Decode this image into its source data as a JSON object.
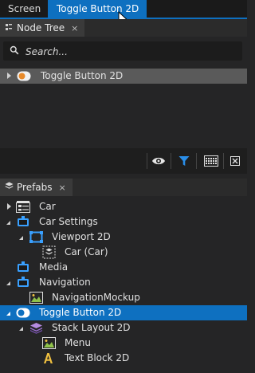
{
  "document_tabs": [
    {
      "label": "Screen"
    },
    {
      "label": "Toggle Button 2D",
      "close": "×"
    }
  ],
  "node_tree": {
    "title": "Node Tree",
    "close": "×",
    "search": {
      "placeholder": "Search..."
    },
    "items": [
      {
        "label": "Toggle Button 2D",
        "selected": true
      }
    ]
  },
  "prefabs": {
    "title": "Prefabs",
    "close": "×",
    "items": [
      {
        "label": "Car"
      },
      {
        "label": "Car Settings"
      },
      {
        "label": "Viewport 2D"
      },
      {
        "label": "Car (Car)"
      },
      {
        "label": "Media"
      },
      {
        "label": "Navigation"
      },
      {
        "label": "NavigationMockup"
      },
      {
        "label": "Toggle Button 2D",
        "selected": true
      },
      {
        "label": "Stack Layout 2D"
      },
      {
        "label": "Menu"
      },
      {
        "label": "Text Block 2D"
      }
    ]
  },
  "toolbar": {
    "icons": [
      "eye-icon",
      "filter-icon",
      "grid-icon",
      "collapse-icon"
    ],
    "accent": "#2a8ee8"
  },
  "colors": {
    "accent": "#0e70c0",
    "background": "#252526",
    "selection_gray": "#5a5a5a"
  }
}
